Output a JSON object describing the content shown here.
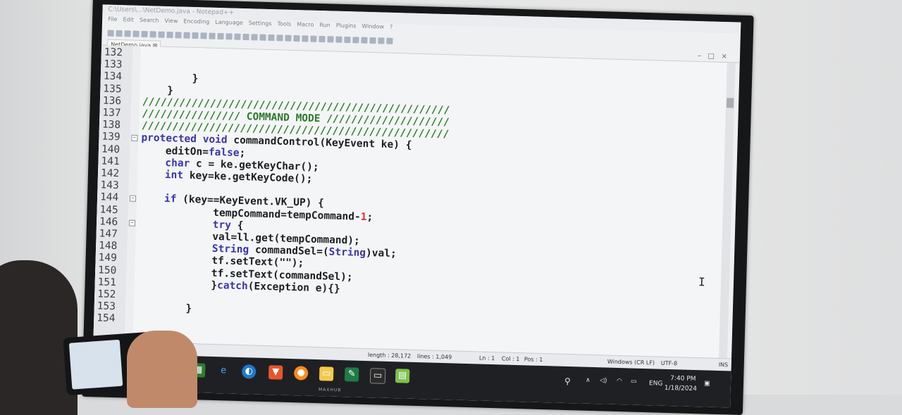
{
  "window": {
    "title": "C:\\Users\\...\\NetDemo.java - Notepad++",
    "menu": [
      "File",
      "Edit",
      "Search",
      "View",
      "Encoding",
      "Language",
      "Settings",
      "Tools",
      "Macro",
      "Run",
      "Plugins",
      "Window",
      "?"
    ],
    "tab_label": "NetDemo.java",
    "controls": [
      "–",
      "□",
      "×"
    ]
  },
  "editor": {
    "lines": [
      {
        "num": "132",
        "code": "",
        "fold": ""
      },
      {
        "num": "133",
        "code": "",
        "fold": ""
      },
      {
        "num": "134",
        "code": "        }",
        "fold": ""
      },
      {
        "num": "135",
        "code": "    }",
        "fold": ""
      },
      {
        "num": "136",
        "code": "//////////////////////////////////////////////////",
        "fold": ""
      },
      {
        "num": "137",
        "code": "//////////////// COMMAND MODE ////////////////////",
        "fold": ""
      },
      {
        "num": "138",
        "code": "//////////////////////////////////////////////////",
        "fold": ""
      },
      {
        "num": "139",
        "code": "protected void commandControl(KeyEvent ke) {",
        "fold": "−"
      },
      {
        "num": "140",
        "code": "    editOn=false;",
        "fold": ""
      },
      {
        "num": "141",
        "code": "    char c = ke.getKeyChar();",
        "fold": ""
      },
      {
        "num": "142",
        "code": "    int key=ke.getKeyCode();",
        "fold": ""
      },
      {
        "num": "143",
        "code": "",
        "fold": ""
      },
      {
        "num": "144",
        "code": "    if (key==KeyEvent.VK_UP) {",
        "fold": "−"
      },
      {
        "num": "145",
        "code": "            tempCommand=tempCommand-1;",
        "fold": ""
      },
      {
        "num": "146",
        "code": "            try {",
        "fold": "−"
      },
      {
        "num": "147",
        "code": "            val=ll.get(tempCommand);",
        "fold": ""
      },
      {
        "num": "148",
        "code": "            String commandSel=(String)val;",
        "fold": ""
      },
      {
        "num": "149",
        "code": "            tf.setText(\"\");",
        "fold": ""
      },
      {
        "num": "150",
        "code": "            tf.setText(commandSel);",
        "fold": ""
      },
      {
        "num": "151",
        "code": "            }catch(Exception e){}",
        "fold": ""
      },
      {
        "num": "152",
        "code": "",
        "fold": ""
      },
      {
        "num": "153",
        "code": "        }",
        "fold": ""
      },
      {
        "num": "154",
        "code": "",
        "fold": ""
      }
    ]
  },
  "status": {
    "length": "length : 28,172",
    "lines": "lines : 1,049",
    "ln": "Ln : 1",
    "col": "Col : 1",
    "pos": "Pos : 1",
    "eol": "Windows (CR LF)",
    "encoding": "UTF-8",
    "mode": "INS"
  },
  "taskbar": {
    "lang": "ENG",
    "time": "7:40 PM",
    "date": "1/18/2024"
  },
  "monitor_brand": "MAXHUB",
  "colors": {
    "keyword": "#3a34b0",
    "comment": "#2c7a2c",
    "number": "#d4342c",
    "taskbar": "#1f2024"
  },
  "icons": [
    "windows-icon",
    "edge-legacy-icon",
    "edge-icon",
    "brave-icon",
    "firefox-icon",
    "folder-icon",
    "excel-icon",
    "terminal-icon",
    "notepadpp-icon"
  ]
}
